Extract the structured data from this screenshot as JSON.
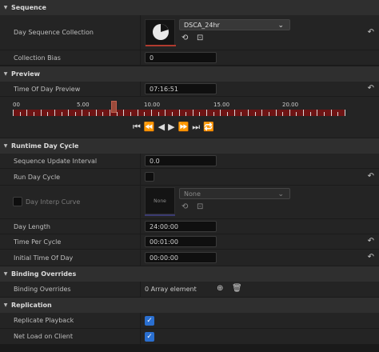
{
  "sections": {
    "sequence": "Sequence",
    "preview": "Preview",
    "runtime": "Runtime Day Cycle",
    "binding": "Binding Overrides",
    "replication": "Replication"
  },
  "sequence": {
    "collection_label": "Day Sequence Collection",
    "collection_value": "DSCA_24hr",
    "bias_label": "Collection Bias",
    "bias_value": "0"
  },
  "preview": {
    "time_label": "Time Of Day Preview",
    "time_value": "07:16:51",
    "timeline_ticks": [
      "00",
      "5.00",
      "10.00",
      "15.00",
      "20.00"
    ],
    "scrubber_fraction": 0.303
  },
  "runtime": {
    "interval_label": "Sequence Update Interval",
    "interval_value": "0.0",
    "run_label": "Run Day Cycle",
    "interp_label": "Day Interp Curve",
    "interp_thumb": "None",
    "interp_dropdown": "None",
    "day_length_label": "Day Length",
    "day_length_value": "24:00:00",
    "tpc_label": "Time Per Cycle",
    "tpc_value": "00:01:00",
    "initial_label": "Initial Time Of Day",
    "initial_value": "00:00:00"
  },
  "binding": {
    "label": "Binding Overrides",
    "value": "0 Array element"
  },
  "replication": {
    "replicate_label": "Replicate Playback",
    "netload_label": "Net Load on Client"
  },
  "icons": {
    "reset": "↶",
    "chev_down": "⌄",
    "arrow_down": "▼"
  }
}
